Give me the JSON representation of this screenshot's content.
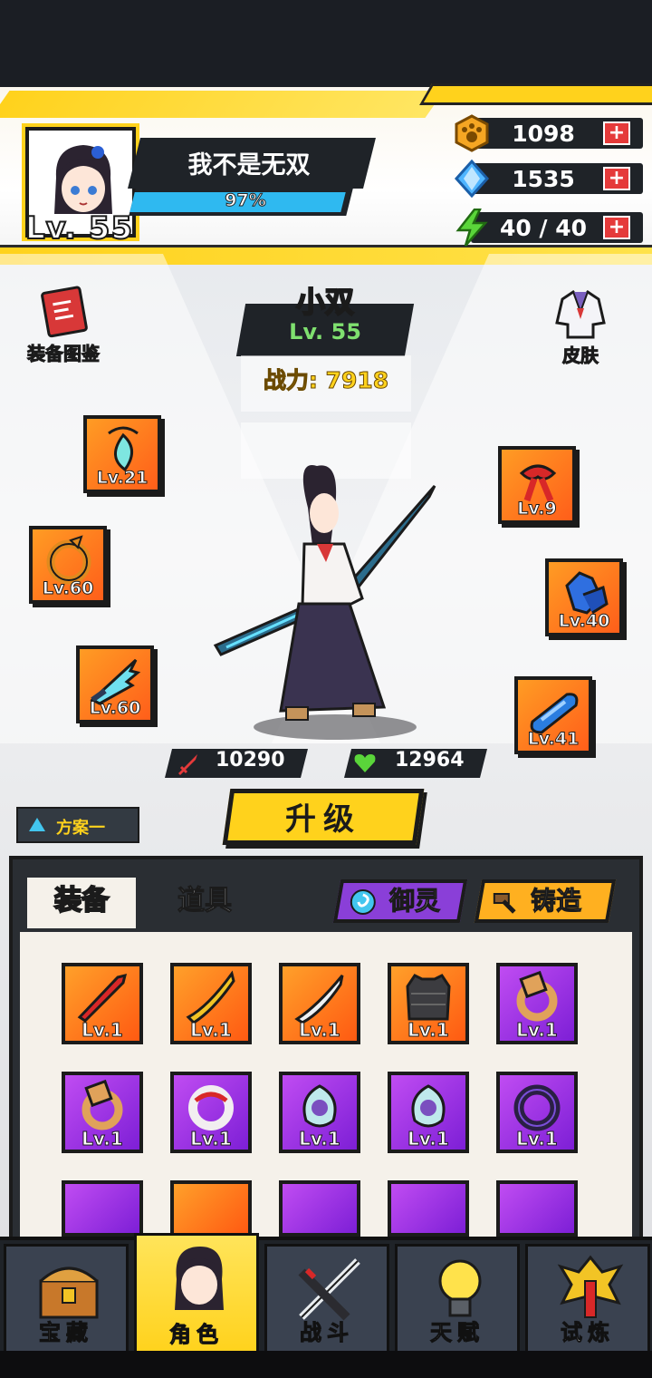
{
  "player": {
    "name": "我不是无双",
    "level_label": "Lv. 55",
    "exp_percent_label": "97%",
    "exp_fraction": 0.97
  },
  "resources": [
    {
      "name": "paw-coin",
      "value": "1098",
      "icon": "paw-icon",
      "color": "#f5a623"
    },
    {
      "name": "diamond",
      "value": "1535",
      "icon": "diamond-icon",
      "color": "#4fb5ff"
    },
    {
      "name": "energy",
      "value": "40 / 40",
      "icon": "lightning-icon",
      "color": "#5ad53a"
    }
  ],
  "side_buttons": {
    "codex": "装备图鉴",
    "skin": "皮肤"
  },
  "character": {
    "name": "小双",
    "level": "Lv. 55",
    "power": "战力: 7918",
    "attack": "10290",
    "health": "12964"
  },
  "equipped_slots": {
    "left": [
      "Lv.21",
      "Lv.60",
      "Lv.60"
    ],
    "right": [
      "Lv.9",
      "Lv.40",
      "Lv.41"
    ]
  },
  "upgrade_button": "升级",
  "scheme_button": "方案一",
  "tabs": {
    "equipment": "装备",
    "items": "道具",
    "spirit": "御灵",
    "forge": "铸造"
  },
  "inventory": [
    {
      "rarity": "orange",
      "level": "Lv.1",
      "icon": "red-blade-icon"
    },
    {
      "rarity": "orange",
      "level": "Lv.1",
      "icon": "yellow-blade-icon"
    },
    {
      "rarity": "orange",
      "level": "Lv.1",
      "icon": "white-blade-icon"
    },
    {
      "rarity": "orange",
      "level": "Lv.1",
      "icon": "armor-vest-icon"
    },
    {
      "rarity": "purple",
      "level": "Lv.1",
      "icon": "ring-icon"
    },
    {
      "rarity": "purple",
      "level": "Lv.1",
      "icon": "ring-icon"
    },
    {
      "rarity": "purple",
      "level": "Lv.1",
      "icon": "red-bracelet-icon"
    },
    {
      "rarity": "purple",
      "level": "Lv.1",
      "icon": "jade-pendant-icon"
    },
    {
      "rarity": "purple",
      "level": "Lv.1",
      "icon": "jade-pendant-icon"
    },
    {
      "rarity": "purple",
      "level": "Lv.1",
      "icon": "dark-bracelet-icon"
    }
  ],
  "bottom_nav": [
    {
      "label": "宝藏",
      "icon": "treasure-chest-icon",
      "active": false
    },
    {
      "label": "角色",
      "icon": "character-icon",
      "active": true
    },
    {
      "label": "战斗",
      "icon": "crossed-swords-icon",
      "active": false
    },
    {
      "label": "天赋",
      "icon": "lightbulb-icon",
      "active": false
    },
    {
      "label": "试炼",
      "icon": "trial-crest-icon",
      "active": false
    }
  ]
}
